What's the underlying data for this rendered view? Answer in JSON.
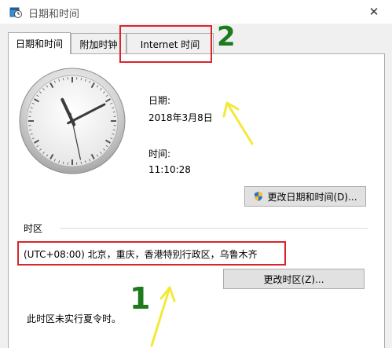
{
  "window": {
    "title": "日期和时间",
    "close_glyph": "✕"
  },
  "tabs": [
    {
      "label": "日期和时间",
      "active": true
    },
    {
      "label": "附加时钟",
      "active": false
    },
    {
      "label": "Internet 时间",
      "active": false
    }
  ],
  "clock": {
    "hour": 11,
    "minute": 10,
    "second": 28
  },
  "date": {
    "label": "日期:",
    "value": "2018年3月8日"
  },
  "time": {
    "label": "时间:",
    "value": "11:10:28"
  },
  "buttons": {
    "change_datetime": "更改日期和时间(D)...",
    "change_timezone": "更改时区(Z)..."
  },
  "timezone": {
    "section_title": "时区",
    "value": "(UTC+08:00) 北京，重庆，香港特别行政区，乌鲁木齐",
    "dst_note": "此时区未实行夏令时。"
  },
  "annotations": {
    "number_1": "1",
    "number_2": "2",
    "highlight_color": "#d9262c",
    "number_color": "#1e7a1e",
    "arrow_color": "#f3e93a"
  },
  "icons": {
    "app": "calendar-clock-icon",
    "shield": "uac-shield-icon",
    "close": "close-icon"
  }
}
